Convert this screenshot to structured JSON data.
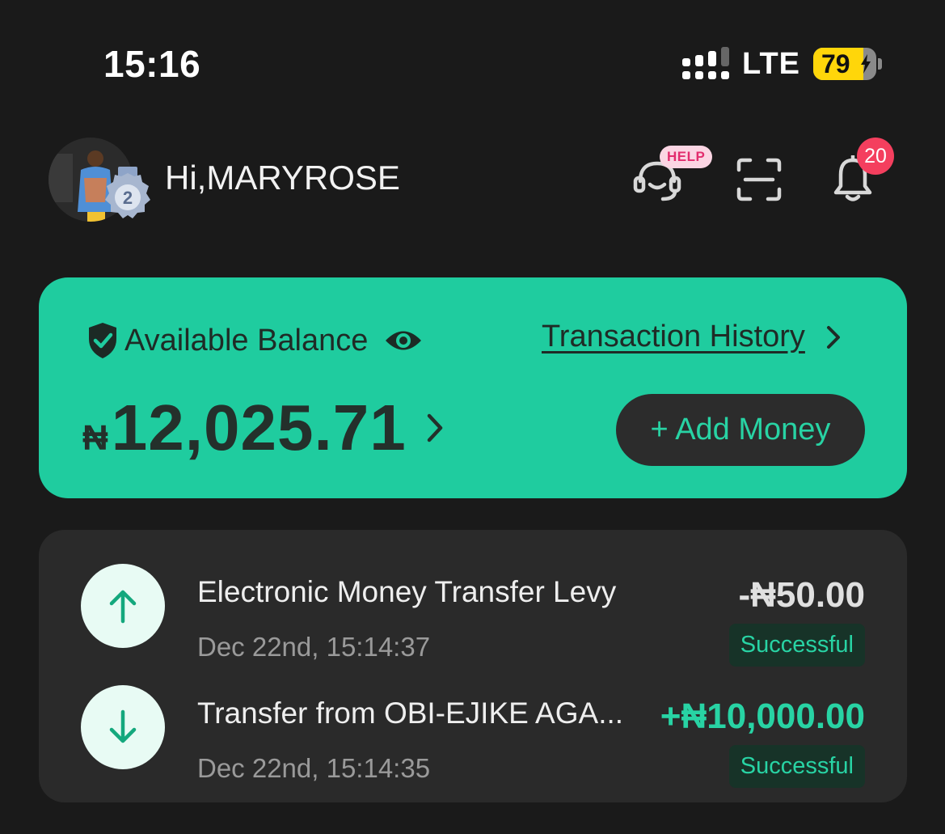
{
  "status_bar": {
    "time": "15:16",
    "network": "LTE",
    "battery": "79",
    "battery_fraction": 0.79
  },
  "header": {
    "greeting": "Hi,MARYROSE",
    "medal_level": "2",
    "help_badge": "HELP",
    "notification_count": "20",
    "icons": [
      "avatar",
      "medal-icon",
      "support-headset-icon",
      "scan-icon",
      "bell-icon"
    ]
  },
  "balance": {
    "label": "Available Balance",
    "transaction_history": "Transaction History",
    "currency": "₦",
    "amount": "12,025.71",
    "add_money": "+ Add Money",
    "icons": [
      "shield-check-icon",
      "eye-icon",
      "chevron-right-icon"
    ]
  },
  "transactions": [
    {
      "title": "Electronic Money Transfer Levy",
      "date": "Dec 22nd, 15:14:37",
      "amount": "-₦50.00",
      "status": "Successful",
      "direction": "outgoing",
      "icon": "arrow-up-icon"
    },
    {
      "title": "Transfer from OBI-EJIKE AGA...",
      "date": "Dec 22nd, 15:14:35",
      "amount": "+₦10,000.00",
      "status": "Successful",
      "direction": "incoming",
      "icon": "arrow-down-icon"
    }
  ],
  "colors": {
    "background": "#1a1a1a",
    "accent_green": "#1fcc9f",
    "card_dark": "#2a2a2a",
    "notification_red": "#f43f5e",
    "battery_yellow": "#ffd60a"
  }
}
